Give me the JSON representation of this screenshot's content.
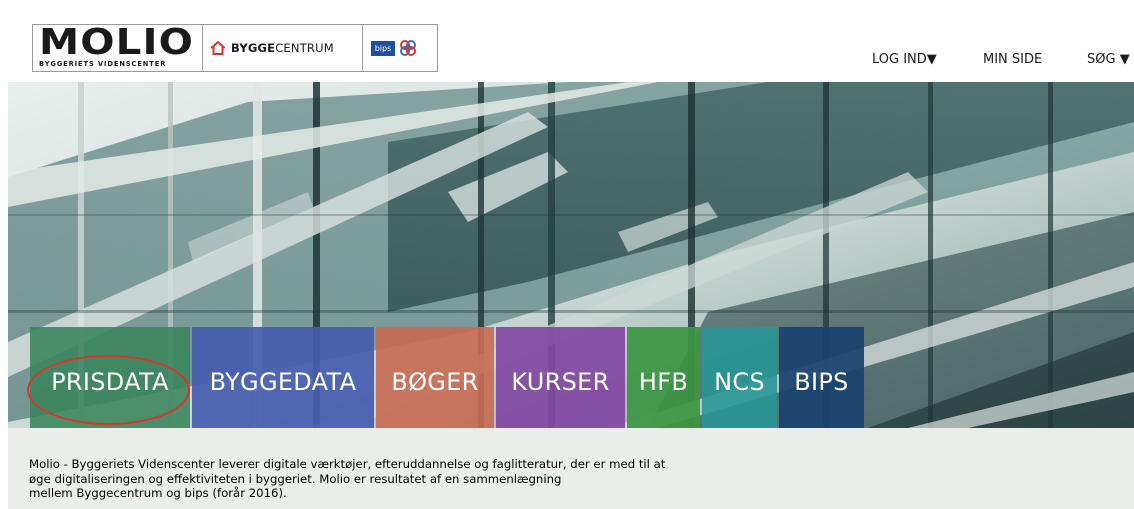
{
  "header": {
    "logos": {
      "molio_word": "MOLIO",
      "molio_sub": "BYGGERIETS VIDENSCENTER",
      "byggecentrum_bold": "BYGGE",
      "byggecentrum_regular": "CENTRUM",
      "bips": "bips"
    },
    "nav": {
      "login": "LOG IND▼",
      "min_side": "MIN SIDE",
      "sog": "SØG ▼"
    }
  },
  "tiles": [
    {
      "label": "PRISDATA",
      "color": "#3a845c"
    },
    {
      "label": "BYGGEDATA",
      "color": "#465caf"
    },
    {
      "label": "BØGER",
      "color": "#c86a52"
    },
    {
      "label": "KURSER",
      "color": "#8248a2"
    },
    {
      "label": "HFB",
      "color": "#3c9642"
    },
    {
      "label": "NCS",
      "color": "#289696"
    },
    {
      "label": "BIPS",
      "color": "#19416e"
    }
  ],
  "intro": {
    "line1": "Molio - Byggeriets Videnscenter leverer digitale værktøjer, efteruddannelse og faglitteratur, der er med til at",
    "line2": "øge digitaliseringen og effektiviteten i byggeriet. Molio er resultatet af en sammenlægning",
    "line3": "mellem Byggecentrum og bips (forår 2016)."
  },
  "colors": {
    "highlight_ring": "#d9362b",
    "intro_background": "#eaedea"
  }
}
